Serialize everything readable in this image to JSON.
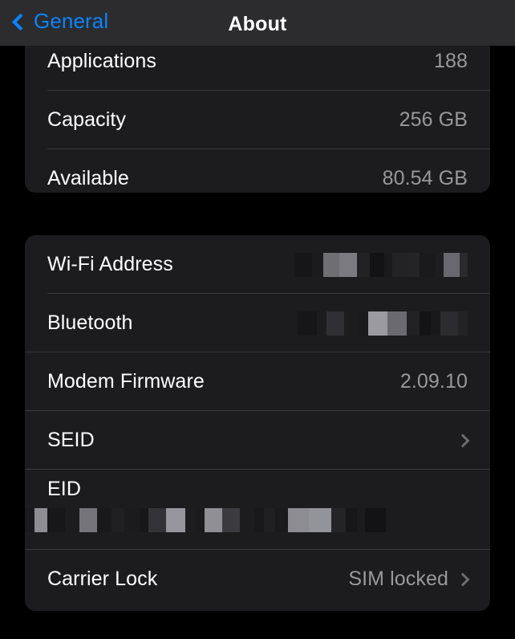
{
  "navbar": {
    "back_label": "General",
    "title": "About",
    "accent_color": "#0a84ff",
    "background_color": "#2c2c2e"
  },
  "theme": {
    "page_background": "#000000",
    "card_background": "#1c1c1e",
    "separator": "#38383a",
    "label_color": "#ffffff",
    "value_color": "#98989d",
    "chevron_color": "#6c6c70"
  },
  "sections": [
    {
      "name": "storage",
      "rows": [
        {
          "label": "Applications",
          "value": "188",
          "clipped": true
        },
        {
          "label": "Capacity",
          "value": "256 GB"
        },
        {
          "label": "Available",
          "value": "80.54 GB"
        }
      ]
    },
    {
      "name": "device-identifiers",
      "rows": [
        {
          "label": "Wi-Fi Address",
          "value": "",
          "redacted": true
        },
        {
          "label": "Bluetooth",
          "value": "",
          "redacted": true
        },
        {
          "label": "Modem Firmware",
          "value": "2.09.10"
        },
        {
          "label": "SEID",
          "value": "",
          "chevron": true
        },
        {
          "label": "EID",
          "value": "",
          "redacted": true
        },
        {
          "label": "Carrier Lock",
          "value": "SIM locked",
          "chevron": true
        }
      ]
    }
  ],
  "redactions": {
    "wifi_address": [
      {
        "w": 22,
        "c": "#161618"
      },
      {
        "w": 14,
        "c": "#1b1b1d"
      },
      {
        "w": 20,
        "c": "#6e6e73"
      },
      {
        "w": 22,
        "c": "#7a7a80"
      },
      {
        "w": 16,
        "c": "#222225"
      },
      {
        "w": 18,
        "c": "#131315"
      },
      {
        "w": 10,
        "c": "#1a1a1c"
      },
      {
        "w": 20,
        "c": "#232326"
      },
      {
        "w": 14,
        "c": "#242427"
      },
      {
        "w": 20,
        "c": "#1a1a1c"
      },
      {
        "w": 10,
        "c": "#1e1e20"
      },
      {
        "w": 20,
        "c": "#68686e"
      },
      {
        "w": 10,
        "c": "#2a2a2d"
      }
    ],
    "bluetooth": [
      {
        "w": 24,
        "c": "#161618"
      },
      {
        "w": 12,
        "c": "#1c1c1e"
      },
      {
        "w": 22,
        "c": "#303034"
      },
      {
        "w": 18,
        "c": "#1d1d1f"
      },
      {
        "w": 12,
        "c": "#1b1b1d"
      },
      {
        "w": 24,
        "c": "#9a9aa0"
      },
      {
        "w": 24,
        "c": "#6a6a70"
      },
      {
        "w": 16,
        "c": "#212124"
      },
      {
        "w": 14,
        "c": "#131315"
      },
      {
        "w": 12,
        "c": "#18181a"
      },
      {
        "w": 22,
        "c": "#2c2c30"
      },
      {
        "w": 12,
        "c": "#232326"
      }
    ],
    "eid": [
      {
        "w": 12,
        "c": "#1a1a1c"
      },
      {
        "w": 16,
        "c": "#8d8d93"
      },
      {
        "w": 22,
        "c": "#17171a"
      },
      {
        "w": 18,
        "c": "#1c1c1e"
      },
      {
        "w": 22,
        "c": "#74747a"
      },
      {
        "w": 18,
        "c": "#19191b"
      },
      {
        "w": 16,
        "c": "#202023"
      },
      {
        "w": 20,
        "c": "#1b1b1d"
      },
      {
        "w": 10,
        "c": "#171719"
      },
      {
        "w": 22,
        "c": "#333337"
      },
      {
        "w": 24,
        "c": "#95959b"
      },
      {
        "w": 14,
        "c": "#1d1d1f"
      },
      {
        "w": 10,
        "c": "#1a1a1c"
      },
      {
        "w": 22,
        "c": "#8f8f95"
      },
      {
        "w": 22,
        "c": "#3b3b3f"
      },
      {
        "w": 18,
        "c": "#1c1c1e"
      },
      {
        "w": 12,
        "c": "#18181a"
      },
      {
        "w": 14,
        "c": "#202023"
      },
      {
        "w": 16,
        "c": "#1a1a1c"
      },
      {
        "w": 26,
        "c": "#8c8c92"
      },
      {
        "w": 28,
        "c": "#93939a"
      },
      {
        "w": 18,
        "c": "#242427"
      },
      {
        "w": 14,
        "c": "#17171a"
      },
      {
        "w": 10,
        "c": "#1b1b1d"
      },
      {
        "w": 26,
        "c": "#131315"
      },
      {
        "w": 16,
        "c": "#1c1c1e"
      }
    ]
  }
}
